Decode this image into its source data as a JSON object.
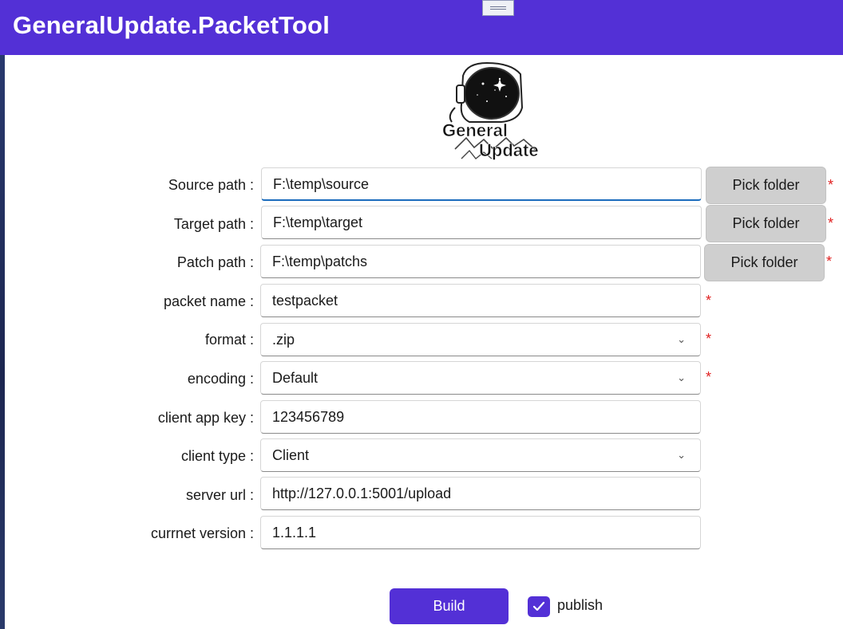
{
  "app": {
    "title": "GeneralUpdate.PacketTool"
  },
  "logo": {
    "line1": "General",
    "line2": "Update"
  },
  "form": {
    "source_path": {
      "label": "Source path :",
      "value": "F:\\temp\\source",
      "button": "Pick folder",
      "required": "*"
    },
    "target_path": {
      "label": "Target path :",
      "value": "F:\\temp\\target",
      "button": "Pick folder",
      "required": "*"
    },
    "patch_path": {
      "label": "Patch path :",
      "value": "F:\\temp\\patchs",
      "button": "Pick folder",
      "required": "*"
    },
    "packet_name": {
      "label": "packet name :",
      "value": "testpacket",
      "required": "*"
    },
    "format": {
      "label": "format :",
      "value": ".zip",
      "required": "*"
    },
    "encoding": {
      "label": "encoding :",
      "value": "Default",
      "required": "*"
    },
    "client_app_key": {
      "label": "client app key :",
      "value": "123456789"
    },
    "client_type": {
      "label": "client type :",
      "value": "Client"
    },
    "server_url": {
      "label": "server url :",
      "value": "http://127.0.0.1:5001/upload"
    },
    "current_version": {
      "label": "currnet version :",
      "value": "1.1.1.1"
    }
  },
  "actions": {
    "build_label": "Build",
    "publish_label": "publish",
    "publish_checked": true
  },
  "colors": {
    "accent": "#5330d6",
    "required": "#e02020",
    "focus": "#1b6cbd"
  }
}
